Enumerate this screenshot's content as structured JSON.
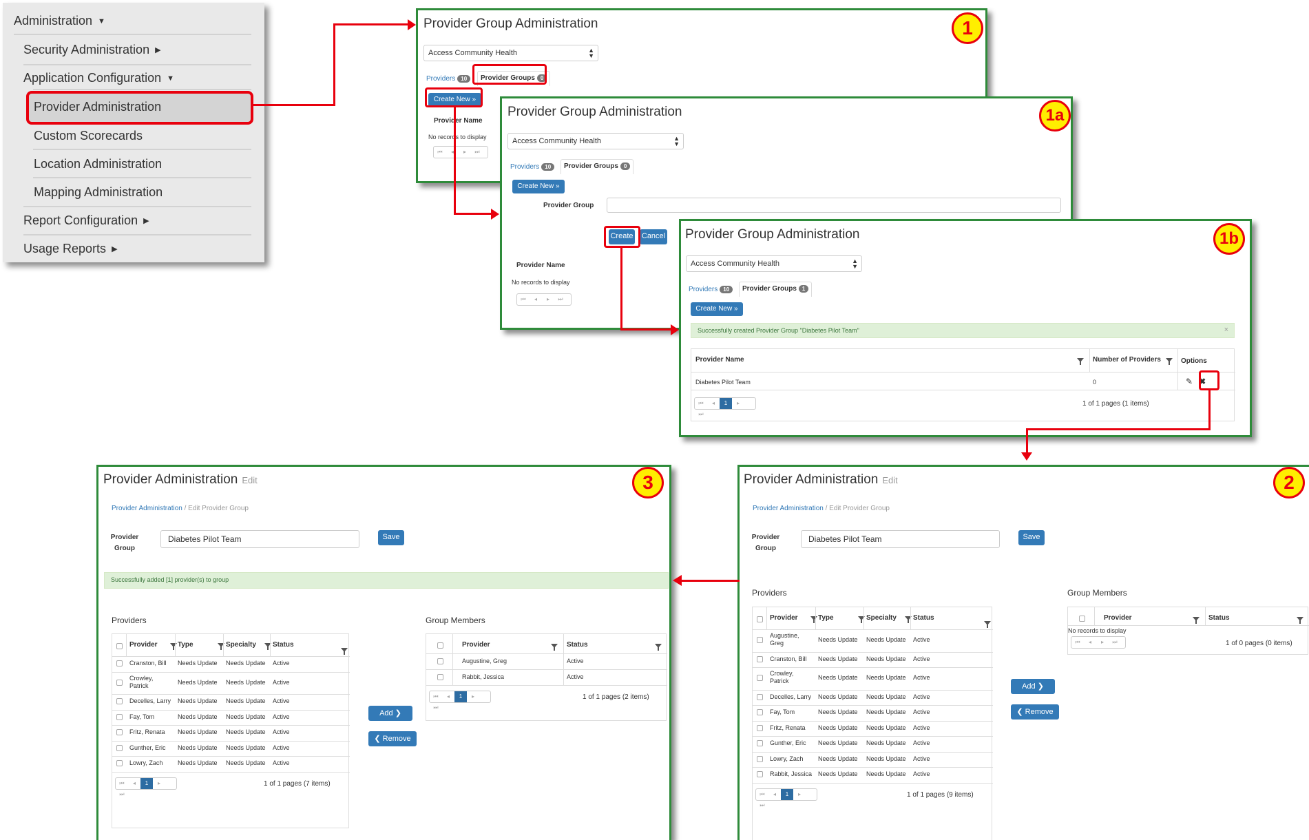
{
  "menu": {
    "items": [
      "Administration",
      "Security Administration",
      "Application Configuration",
      "Provider Administration",
      "Custom Scorecards",
      "Location Administration",
      "Mapping Administration",
      "Report Configuration",
      "Usage Reports"
    ]
  },
  "p1": {
    "title": "Provider Group Administration",
    "badge": "1",
    "select": "Access Community Health",
    "tab_providers": "Providers",
    "tab_providers_count": "10",
    "tab_groups": "Provider Groups",
    "tab_groups_count": "0",
    "create_btn": "Create New »",
    "col": "Provider Name",
    "empty": "No records to display"
  },
  "p1a": {
    "title": "Provider Group Administration",
    "badge": "1a",
    "select": "Access Community Health",
    "tab_providers": "Providers",
    "tab_providers_count": "10",
    "tab_groups": "Provider Groups",
    "tab_groups_count": "0",
    "create_btn": "Create New »",
    "field_label": "Provider Group",
    "create": "Create",
    "cancel": "Cancel",
    "col": "Provider Name",
    "empty": "No records to display"
  },
  "p1b": {
    "title": "Provider Group Administration",
    "badge": "1b",
    "select": "Access Community Health",
    "tab_providers": "Providers",
    "tab_providers_count": "10",
    "tab_groups": "Provider Groups",
    "tab_groups_count": "1",
    "create_btn": "Create New »",
    "alert": "Successfully created Provider Group \"Diabetes Pilot Team\"",
    "alert_close": "×",
    "col_name": "Provider Name",
    "col_num": "Number of Providers",
    "col_opt": "Options",
    "row_name": "Diabetes Pilot Team",
    "row_num": "0",
    "page": "1",
    "pager_text": "1 of 1 pages (1 items)"
  },
  "p2": {
    "title": "Provider Administration",
    "title_sub": "Edit",
    "badge": "2",
    "bc_link": "Provider Administration",
    "bc_sep": "/",
    "bc_cur": "Edit Provider Group",
    "field_label": "Provider Group",
    "field_value": "Diabetes Pilot Team",
    "save": "Save",
    "providers_title": "Providers",
    "members_title": "Group Members",
    "cols": [
      "Provider",
      "Type",
      "Specialty",
      "Status"
    ],
    "rows": [
      [
        "Augustine, Greg",
        "Needs Update",
        "Needs Update",
        "Active"
      ],
      [
        "Cranston, Bill",
        "Needs Update",
        "Needs Update",
        "Active"
      ],
      [
        "Crowley, Patrick",
        "Needs Update",
        "Needs Update",
        "Active"
      ],
      [
        "Decelles, Larry",
        "Needs Update",
        "Needs Update",
        "Active"
      ],
      [
        "Fay, Tom",
        "Needs Update",
        "Needs Update",
        "Active"
      ],
      [
        "Fritz, Renata",
        "Needs Update",
        "Needs Update",
        "Active"
      ],
      [
        "Gunther, Eric",
        "Needs Update",
        "Needs Update",
        "Active"
      ],
      [
        "Lowry, Zach",
        "Needs Update",
        "Needs Update",
        "Active"
      ],
      [
        "Rabbit, Jessica",
        "Needs Update",
        "Needs Update",
        "Active"
      ]
    ],
    "add": "Add ❯",
    "remove": "❮ Remove",
    "member_cols": [
      "Provider",
      "Status"
    ],
    "member_empty": "No records to display",
    "member_pager": "1 of 0 pages (0 items)",
    "page": "1",
    "pager_text": "1 of 1 pages (9 items)"
  },
  "p3": {
    "title": "Provider Administration",
    "title_sub": "Edit",
    "badge": "3",
    "bc_link": "Provider Administration",
    "bc_sep": "/",
    "bc_cur": "Edit Provider Group",
    "field_label": "Provider Group",
    "field_value": "Diabetes Pilot Team",
    "save": "Save",
    "alert": "Successfully added [1] provider(s) to group",
    "providers_title": "Providers",
    "members_title": "Group Members",
    "cols": [
      "Provider",
      "Type",
      "Specialty",
      "Status"
    ],
    "rows": [
      [
        "Cranston, Bill",
        "Needs Update",
        "Needs Update",
        "Active"
      ],
      [
        "Crowley, Patrick",
        "Needs Update",
        "Needs Update",
        "Active"
      ],
      [
        "Decelles, Larry",
        "Needs Update",
        "Needs Update",
        "Active"
      ],
      [
        "Fay, Tom",
        "Needs Update",
        "Needs Update",
        "Active"
      ],
      [
        "Fritz, Renata",
        "Needs Update",
        "Needs Update",
        "Active"
      ],
      [
        "Gunther, Eric",
        "Needs Update",
        "Needs Update",
        "Active"
      ],
      [
        "Lowry, Zach",
        "Needs Update",
        "Needs Update",
        "Active"
      ]
    ],
    "add": "Add ❯",
    "remove": "❮ Remove",
    "member_cols": [
      "Provider",
      "Status"
    ],
    "members": [
      [
        "Augustine, Greg",
        "Active"
      ],
      [
        "Rabbit, Jessica",
        "Active"
      ]
    ],
    "page": "1",
    "pager_text": "1 of 1 pages (7 items)",
    "member_pager": "1 of 1 pages (2 items)"
  },
  "colors": {
    "accent": "#337ab7",
    "panel_border": "#2e8b3a",
    "callout": "#e8000d",
    "badge_fill": "#ffee00",
    "success_bg": "#dff0d8"
  }
}
